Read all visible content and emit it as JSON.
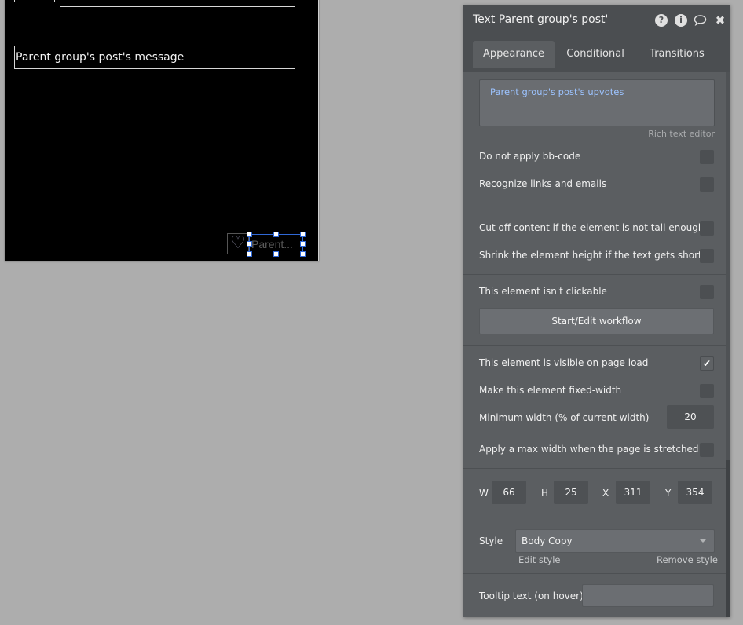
{
  "canvas": {
    "message_text": "Parent group's post's message",
    "selected_text": "Parent...",
    "heart_glyph": "♡"
  },
  "panel": {
    "title": "Text Parent group's post'",
    "header_icons": [
      "help-icon",
      "info-icon",
      "comment-icon",
      "close-icon"
    ],
    "tabs": [
      {
        "label": "Appearance",
        "active": true
      },
      {
        "label": "Conditional",
        "active": false
      },
      {
        "label": "Transitions",
        "active": false
      }
    ],
    "content": {
      "dynamic_text": "Parent group's post's upvotes",
      "rich_text_label": "Rich text editor"
    },
    "options": {
      "no_bbcode": {
        "label": "Do not apply bb-code",
        "checked": false
      },
      "recognize_links": {
        "label": "Recognize links and emails",
        "checked": false
      },
      "cut_off": {
        "label": "Cut off content if the element is not tall enough",
        "checked": false
      },
      "shrink": {
        "label": "Shrink the element height if the text gets shorter",
        "checked": false
      },
      "not_clickable": {
        "label": "This element isn't clickable",
        "checked": false
      },
      "visible_on_load": {
        "label": "This element is visible on page load",
        "checked": true
      },
      "fixed_width": {
        "label": "Make this element fixed-width",
        "checked": false
      },
      "min_width_label": "Minimum width (% of current width)",
      "min_width_value": "20",
      "max_width": {
        "label": "Apply a max width when the page is stretched",
        "checked": false
      }
    },
    "workflow_button": "Start/Edit workflow",
    "dimensions": {
      "w_label": "W",
      "w": "66",
      "h_label": "H",
      "h": "25",
      "x_label": "X",
      "x": "311",
      "y_label": "Y",
      "y": "354"
    },
    "style": {
      "label": "Style",
      "value": "Body Copy",
      "edit_link": "Edit style",
      "remove_link": "Remove style"
    },
    "tooltip": {
      "label": "Tooltip text (on hover)",
      "value": ""
    },
    "colors": {
      "panel_bg": "#5b5e61",
      "header_bg": "#4b4e51",
      "dynamic_text": "#9cc3ff",
      "selection": "#2f68d6"
    }
  }
}
